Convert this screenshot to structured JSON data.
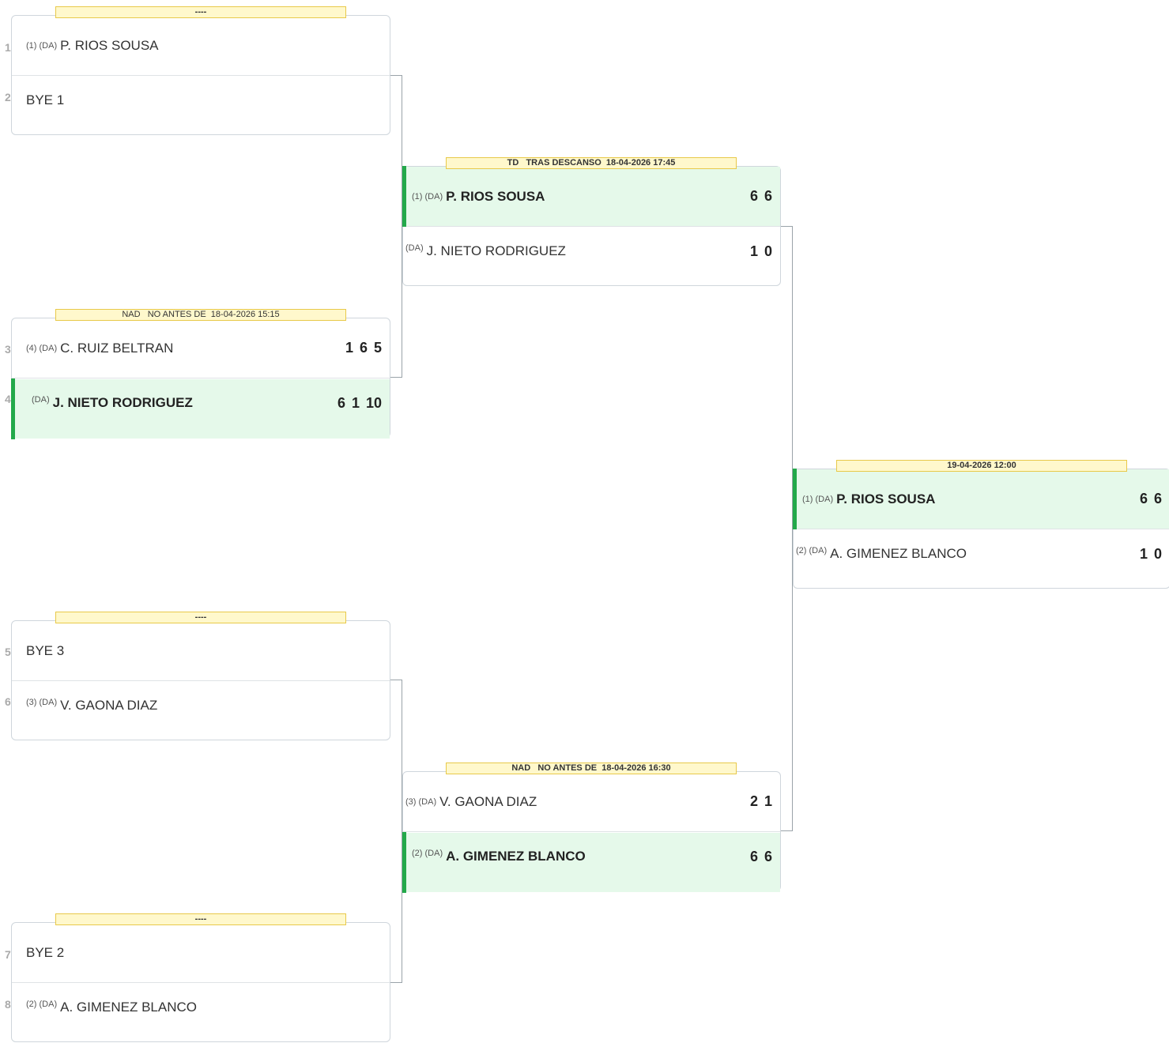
{
  "draw_positions": [
    "1",
    "2",
    "3",
    "4",
    "5",
    "6",
    "7",
    "8"
  ],
  "round1": [
    {
      "label": "----",
      "p1": {
        "seed": "(1) (DA)",
        "name": "P. RIOS SOUSA"
      },
      "p2": {
        "seed": "",
        "name": "BYE 1"
      }
    },
    {
      "label": "NAD   NO ANTES DE  18-04-2026 15:15",
      "p1": {
        "seed": "(4) (DA)",
        "name": "C. RUIZ BELTRAN",
        "scores": [
          "1",
          "6",
          "5"
        ]
      },
      "p2": {
        "seed": "(DA)",
        "name": "J. NIETO RODRIGUEZ",
        "scores": [
          "6",
          "1",
          "10"
        ]
      }
    },
    {
      "label": "----",
      "p1": {
        "seed": "",
        "name": "BYE 3"
      },
      "p2": {
        "seed": "(3) (DA)",
        "name": "V. GAONA DIAZ"
      }
    },
    {
      "label": "----",
      "p1": {
        "seed": "",
        "name": "BYE 2"
      },
      "p2": {
        "seed": "(2) (DA)",
        "name": "A. GIMENEZ BLANCO"
      }
    }
  ],
  "round2": [
    {
      "label": "TD   TRAS DESCANSO  18-04-2026 17:45",
      "p1": {
        "seed": "(1) (DA)",
        "name": "P. RIOS SOUSA",
        "scores": [
          "6",
          "6"
        ]
      },
      "p2": {
        "seed": "(DA)",
        "name": "J. NIETO RODRIGUEZ",
        "scores": [
          "1",
          "0"
        ]
      }
    },
    {
      "label": "NAD   NO ANTES DE  18-04-2026 16:30",
      "p1": {
        "seed": "(3) (DA)",
        "name": "V. GAONA DIAZ",
        "scores": [
          "2",
          "1"
        ]
      },
      "p2": {
        "seed": "(2) (DA)",
        "name": "A. GIMENEZ BLANCO",
        "scores": [
          "6",
          "6"
        ]
      }
    }
  ],
  "final": {
    "label": "19-04-2026 12:00",
    "p1": {
      "seed": "(1) (DA)",
      "name": "P. RIOS SOUSA",
      "scores": [
        "6",
        "6"
      ]
    },
    "p2": {
      "seed": "(2) (DA)",
      "name": "A. GIMENEZ BLANCO",
      "scores": [
        "1",
        "0"
      ]
    }
  },
  "colors": {
    "winner_bg": "#e5f9ea",
    "winner_bar": "#23a94a",
    "label_bg": "#fff8cc",
    "label_border": "#e8c94a"
  }
}
